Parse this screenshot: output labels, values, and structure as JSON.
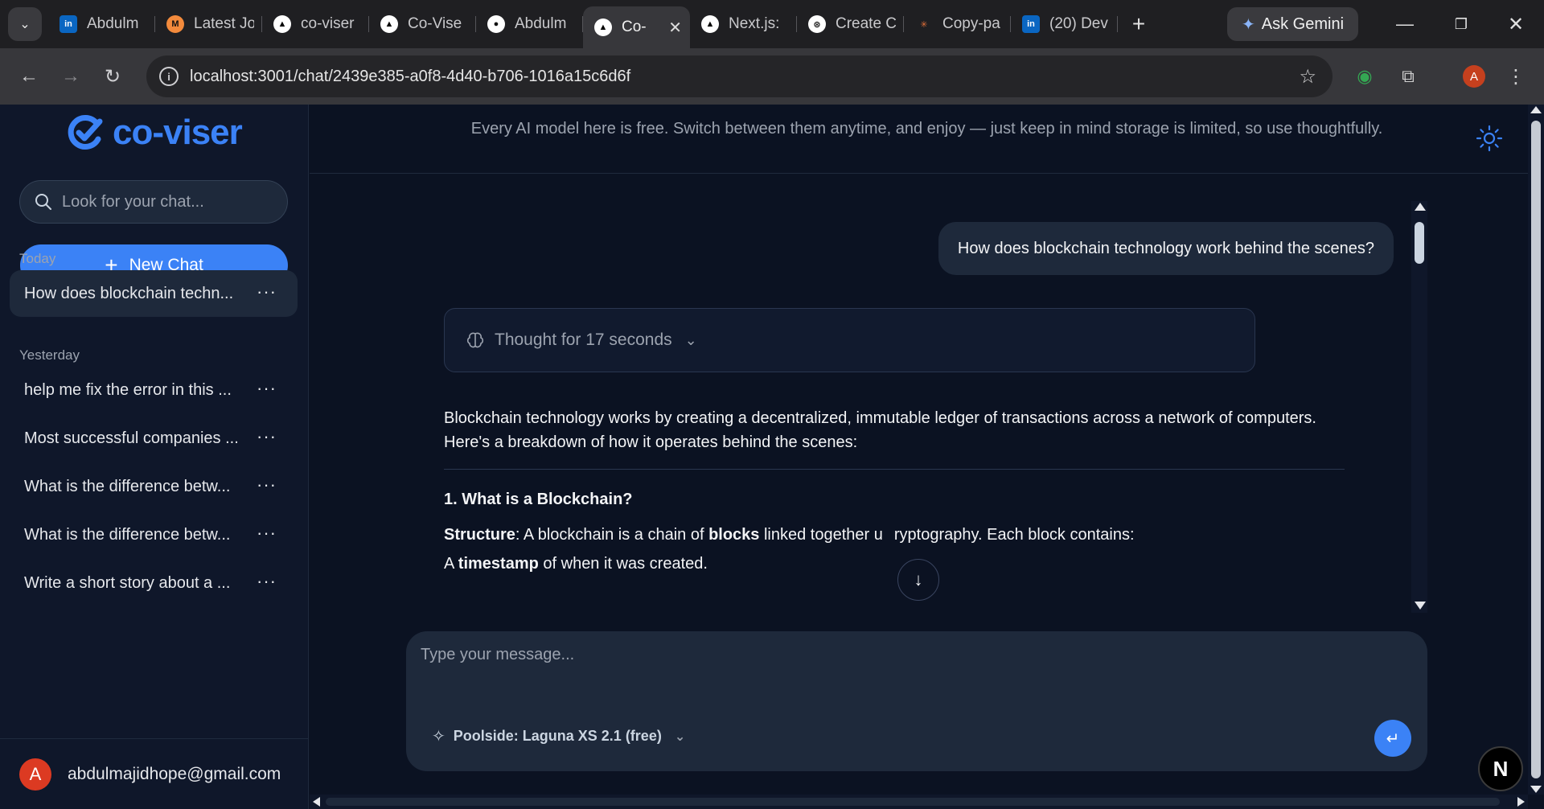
{
  "browser": {
    "tabs": [
      {
        "label": "Abdulm",
        "icon": "linkedin-icon",
        "fav_text": "in",
        "fav_bg": "#0a66c2",
        "fav_color": "#ffffff"
      },
      {
        "label": "Latest Jo",
        "icon": "medium-m-icon",
        "fav_text": "M",
        "fav_bg": "#f38a3c",
        "fav_color": "#111111"
      },
      {
        "label": "co-viser",
        "icon": "vercel-triangle-icon",
        "fav_text": "▲",
        "fav_bg": "#ffffff",
        "fav_color": "#000000"
      },
      {
        "label": "Co-Vise",
        "icon": "vercel-triangle-icon",
        "fav_text": "▲",
        "fav_bg": "#ffffff",
        "fav_color": "#000000"
      },
      {
        "label": "Abdulm",
        "icon": "github-icon",
        "fav_text": "●",
        "fav_bg": "#ffffff",
        "fav_color": "#111111"
      },
      {
        "label": "Co-",
        "icon": "vercel-triangle-icon",
        "fav_text": "▲",
        "fav_bg": "#ffffff",
        "fav_color": "#000000",
        "active": true
      },
      {
        "label": "Next.js:",
        "icon": "vercel-triangle-icon",
        "fav_text": "▲",
        "fav_bg": "#ffffff",
        "fav_color": "#000000"
      },
      {
        "label": "Create C",
        "icon": "openai-icon",
        "fav_text": "⊛",
        "fav_bg": "#ffffff",
        "fav_color": "#111111"
      },
      {
        "label": "Copy-pa",
        "icon": "claude-sparkle-icon",
        "fav_text": "✳",
        "fav_bg": "transparent",
        "fav_color": "#e2703a"
      },
      {
        "label": "(20) Dev",
        "icon": "linkedin-icon",
        "fav_text": "in",
        "fav_bg": "#0a66c2",
        "fav_color": "#ffffff"
      }
    ],
    "gemini_label": "Ask Gemini",
    "url": "localhost:3001/chat/2439e385-a0f8-4d40-b706-1016a15c6d6f",
    "profile_initial": "A"
  },
  "sidebar": {
    "logo_text": "co-viser",
    "search_placeholder": "Look for your chat...",
    "new_chat_label": "New Chat",
    "today_label": "Today",
    "yesterday_label": "Yesterday",
    "today_items": [
      {
        "title": "How does blockchain techn..."
      }
    ],
    "yesterday_items": [
      {
        "title": "help me fix the error in this ..."
      },
      {
        "title": "Most successful companies ..."
      },
      {
        "title": "What is the difference betw..."
      },
      {
        "title": "What is the difference betw..."
      },
      {
        "title": "Write a short story about a ..."
      }
    ],
    "more_label": "···",
    "user": {
      "initial": "A",
      "email": "abdulmajidhope@gmail.com"
    }
  },
  "main": {
    "notice": "Every AI model here is free. Switch between them anytime, and enjoy — just keep in mind storage is limited, so use thoughtfully.",
    "user_message": "How does blockchain technology work behind the scenes?",
    "thought_label": "Thought for 17 seconds",
    "assistant": {
      "intro": "Blockchain technology works by creating a decentralized, immutable ledger of transactions across a network of computers. Here's a breakdown of how it operates behind the scenes:",
      "heading": "1. What is a Blockchain?",
      "structure_label": "Structure",
      "structure_text_1": ": A blockchain is a chain of ",
      "structure_bold": "blocks",
      "structure_text_2": " linked together u",
      "structure_text_3": "ryptography. Each block contains:",
      "timestamp_prefix": "A ",
      "timestamp_bold": "timestamp",
      "timestamp_suffix": " of when it was created."
    },
    "composer": {
      "placeholder": "Type your message...",
      "model_label": "Poolside: Laguna XS 2.1 (free)"
    },
    "next_badge": "N"
  },
  "colors": {
    "accent": "#3b82f6",
    "background": "#0b1222",
    "sidebar": "#0f172a",
    "surface": "#1e293b"
  }
}
